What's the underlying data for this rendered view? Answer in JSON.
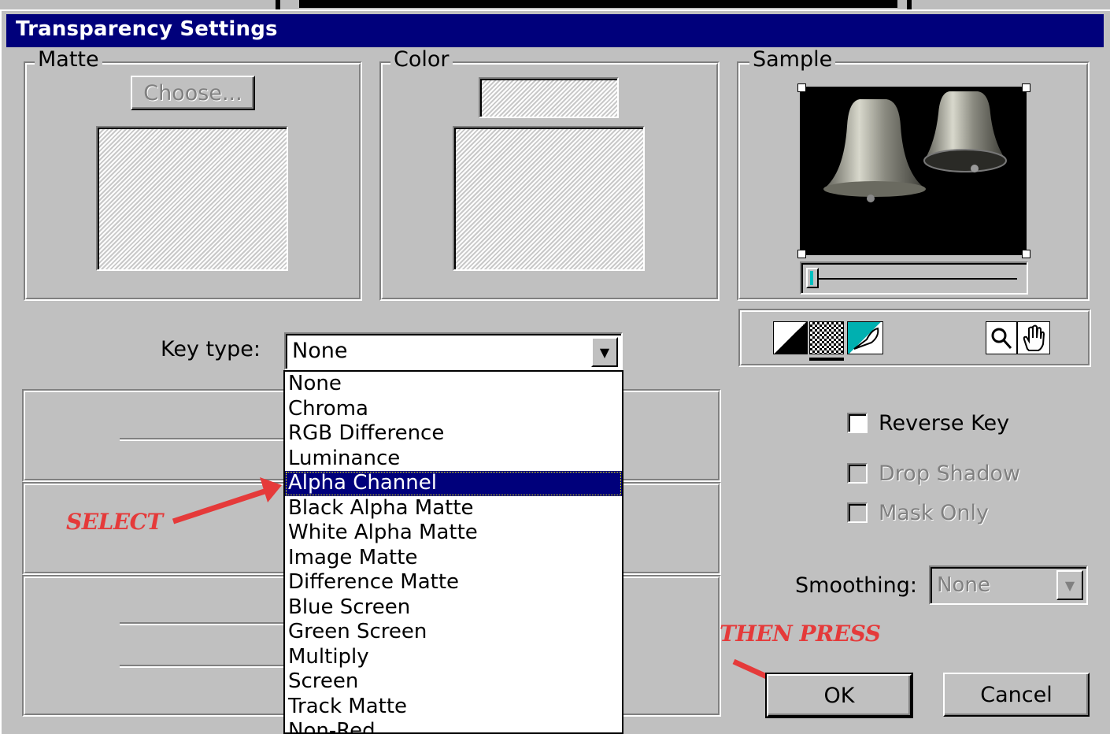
{
  "window": {
    "title": "Transparency Settings"
  },
  "matte_group": {
    "legend": "Matte",
    "choose_button": "Choose..."
  },
  "color_group": {
    "legend": "Color"
  },
  "sample_group": {
    "legend": "Sample",
    "slider_value": 0.05
  },
  "key_type": {
    "label": "Key type:",
    "selected": "None",
    "options": [
      "None",
      "Chroma",
      "RGB Difference",
      "Luminance",
      "Alpha Channel",
      "Black Alpha Matte",
      "White Alpha Matte",
      "Image Matte",
      "Difference Matte",
      "Blue Screen",
      "Green Screen",
      "Multiply",
      "Screen",
      "Track Matte",
      "Non-Red"
    ],
    "highlighted": "Alpha Channel"
  },
  "checkboxes": {
    "reverse_key": "Reverse Key",
    "drop_shadow": "Drop Shadow",
    "mask_only": "Mask Only"
  },
  "smoothing": {
    "label": "Smoothing:",
    "value": "None"
  },
  "buttons": {
    "ok": "OK",
    "cancel": "Cancel"
  },
  "annotations": {
    "select": "SELECT",
    "then_press": "THEN PRESS",
    "color": "#e53a3a"
  },
  "colors": {
    "titlebar": "#00007b",
    "dialog": "#c0c0c0",
    "highlight": "#00007b"
  },
  "icons": [
    "black-white-background-icon",
    "checkerboard-background-icon",
    "alpha-channel-icon",
    "zoom-icon",
    "hand-icon"
  ]
}
